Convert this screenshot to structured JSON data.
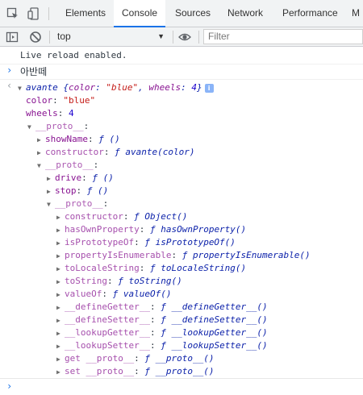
{
  "tabs": [
    "Elements",
    "Console",
    "Sources",
    "Network",
    "Performance",
    "M"
  ],
  "toolbar": {
    "context": "top",
    "filter_placeholder": "Filter"
  },
  "console": {
    "live_reload": "Live reload enabled.",
    "input_text": "아반떼",
    "object_summary": {
      "name": "avante",
      "open": "{",
      "k1": "color",
      "v1": "\"blue\"",
      "k2": "wheels",
      "v2": "4",
      "close": "}"
    },
    "rows": [
      {
        "indent": 1,
        "tri": "",
        "key": "color",
        "sep": ": ",
        "val": "\"blue\"",
        "kind": "str"
      },
      {
        "indent": 1,
        "tri": "",
        "key": "wheels",
        "sep": ": ",
        "val": "4",
        "kind": "num"
      },
      {
        "indent": 1,
        "tri": "▼",
        "key": "__proto__",
        "sep": ":",
        "val": "",
        "kind": "proto"
      },
      {
        "indent": 2,
        "tri": "▶",
        "key": "showName",
        "sep": ": ",
        "val": "ƒ ()",
        "kind": "fn"
      },
      {
        "indent": 2,
        "tri": "▶",
        "key": "constructor",
        "sep": ": ",
        "val": "ƒ avante(color)",
        "kind": "fnp"
      },
      {
        "indent": 2,
        "tri": "▼",
        "key": "__proto__",
        "sep": ":",
        "val": "",
        "kind": "proto"
      },
      {
        "indent": 3,
        "tri": "▶",
        "key": "drive",
        "sep": ": ",
        "val": "ƒ ()",
        "kind": "fn"
      },
      {
        "indent": 3,
        "tri": "▶",
        "key": "stop",
        "sep": ": ",
        "val": "ƒ ()",
        "kind": "fn"
      },
      {
        "indent": 3,
        "tri": "▼",
        "key": "__proto__",
        "sep": ":",
        "val": "",
        "kind": "proto"
      },
      {
        "indent": 4,
        "tri": "▶",
        "key": "constructor",
        "sep": ": ",
        "val": "ƒ Object()",
        "kind": "fnp"
      },
      {
        "indent": 4,
        "tri": "▶",
        "key": "hasOwnProperty",
        "sep": ": ",
        "val": "ƒ hasOwnProperty()",
        "kind": "fnp"
      },
      {
        "indent": 4,
        "tri": "▶",
        "key": "isPrototypeOf",
        "sep": ": ",
        "val": "ƒ isPrototypeOf()",
        "kind": "fnp"
      },
      {
        "indent": 4,
        "tri": "▶",
        "key": "propertyIsEnumerable",
        "sep": ": ",
        "val": "ƒ propertyIsEnumerable()",
        "kind": "fnp"
      },
      {
        "indent": 4,
        "tri": "▶",
        "key": "toLocaleString",
        "sep": ": ",
        "val": "ƒ toLocaleString()",
        "kind": "fnp"
      },
      {
        "indent": 4,
        "tri": "▶",
        "key": "toString",
        "sep": ": ",
        "val": "ƒ toString()",
        "kind": "fnp"
      },
      {
        "indent": 4,
        "tri": "▶",
        "key": "valueOf",
        "sep": ": ",
        "val": "ƒ valueOf()",
        "kind": "fnp"
      },
      {
        "indent": 4,
        "tri": "▶",
        "key": "__defineGetter__",
        "sep": ": ",
        "val": "ƒ __defineGetter__()",
        "kind": "fnp"
      },
      {
        "indent": 4,
        "tri": "▶",
        "key": "__defineSetter__",
        "sep": ": ",
        "val": "ƒ __defineSetter__()",
        "kind": "fnp"
      },
      {
        "indent": 4,
        "tri": "▶",
        "key": "__lookupGetter__",
        "sep": ": ",
        "val": "ƒ __lookupGetter__()",
        "kind": "fnp"
      },
      {
        "indent": 4,
        "tri": "▶",
        "key": "__lookupSetter__",
        "sep": ": ",
        "val": "ƒ __lookupSetter__()",
        "kind": "fnp"
      },
      {
        "indent": 4,
        "tri": "▶",
        "key": "get __proto__",
        "sep": ": ",
        "val": "ƒ __proto__()",
        "kind": "fnp"
      },
      {
        "indent": 4,
        "tri": "▶",
        "key": "set __proto__",
        "sep": ": ",
        "val": "ƒ __proto__()",
        "kind": "fnp"
      }
    ]
  },
  "colors": {
    "accent": "#1a73e8",
    "key": "#881391",
    "string": "#c41a16",
    "number": "#1c00cf",
    "function": "#0d22aa"
  },
  "icons": [
    "inspect-icon",
    "device-toolbar-icon",
    "sidebar-toggle-icon",
    "clear-console-icon",
    "eye-icon",
    "info-icon"
  ]
}
